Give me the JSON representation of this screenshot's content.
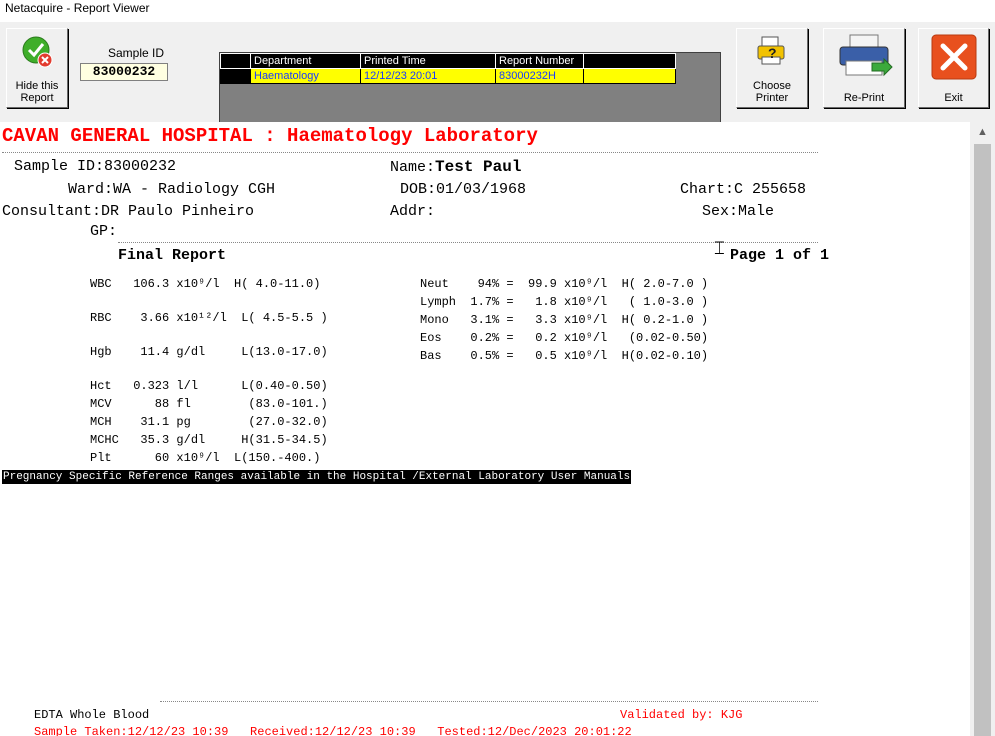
{
  "window": {
    "title": "Netacquire - Report Viewer"
  },
  "toolbar": {
    "hide_label": "Hide this Report",
    "sample_id_label": "Sample ID",
    "sample_id_value": "83000232",
    "choose_printer_label": "Choose Printer",
    "reprint_label": "Re-Print",
    "exit_label": "Exit"
  },
  "grid": {
    "headers": [
      "Department",
      "Printed Time",
      "Report Number"
    ],
    "row": [
      "Haematology",
      "12/12/23 20:01",
      "83000232H"
    ]
  },
  "report": {
    "hospital_title": "CAVAN GENERAL HOSPITAL : Haematology Laboratory",
    "sample_id": "Sample ID:83000232",
    "name_label": "Name:",
    "name_value": "Test Paul",
    "ward": "Ward:WA - Radiology CGH",
    "dob": "DOB:01/03/1968",
    "chart": "Chart:C 255658",
    "consultant": "Consultant:DR Paulo Pinheiro",
    "addr": "Addr:",
    "sex": "Sex:Male",
    "gp": "GP:",
    "final_report": "Final Report",
    "page": "Page 1 of 1",
    "results_left": [
      "WBC   106.3 x10⁹/l  H( 4.0-11.0)",
      "",
      "RBC    3.66 x10¹²/l  L( 4.5-5.5 )",
      "",
      "Hgb    11.4 g/dl     L(13.0-17.0)",
      "",
      "Hct   0.323 l/l      L(0.40-0.50)",
      "MCV      88 fl        (83.0-101.)",
      "MCH    31.1 pg        (27.0-32.0)",
      "MCHC   35.3 g/dl     H(31.5-34.5)",
      "Plt      60 x10⁹/l  L(150.-400.)"
    ],
    "results_right": [
      "Neut    94% =  99.9 x10⁹/l  H( 2.0-7.0 )",
      "Lymph  1.7% =   1.8 x10⁹/l   ( 1.0-3.0 )",
      "Mono   3.1% =   3.3 x10⁹/l  H( 0.2-1.0 )",
      "Eos    0.2% =   0.2 x10⁹/l   (0.02-0.50)",
      "Bas    0.5% =   0.5 x10⁹/l  H(0.02-0.10)"
    ],
    "banner": "Pregnancy Specific Reference Ranges available in the Hospital /External Laboratory User Manuals",
    "specimen": "EDTA Whole Blood",
    "validated": "Validated by: KJG",
    "footer": "Sample Taken:12/12/23 10:39   Received:12/12/23 10:39   Tested:12/Dec/2023 20:01:22"
  },
  "colors": {
    "hospital_title": "#ff0000",
    "grid_row_bg": "#ffff00",
    "grid_row_text": "#1a3cff",
    "exit_bg": "#e8501e"
  },
  "icons": {
    "hide": "check-cancel-icon",
    "printer_choose": "printer-question-icon",
    "reprint": "printer-arrow-icon",
    "exit": "close-icon"
  }
}
